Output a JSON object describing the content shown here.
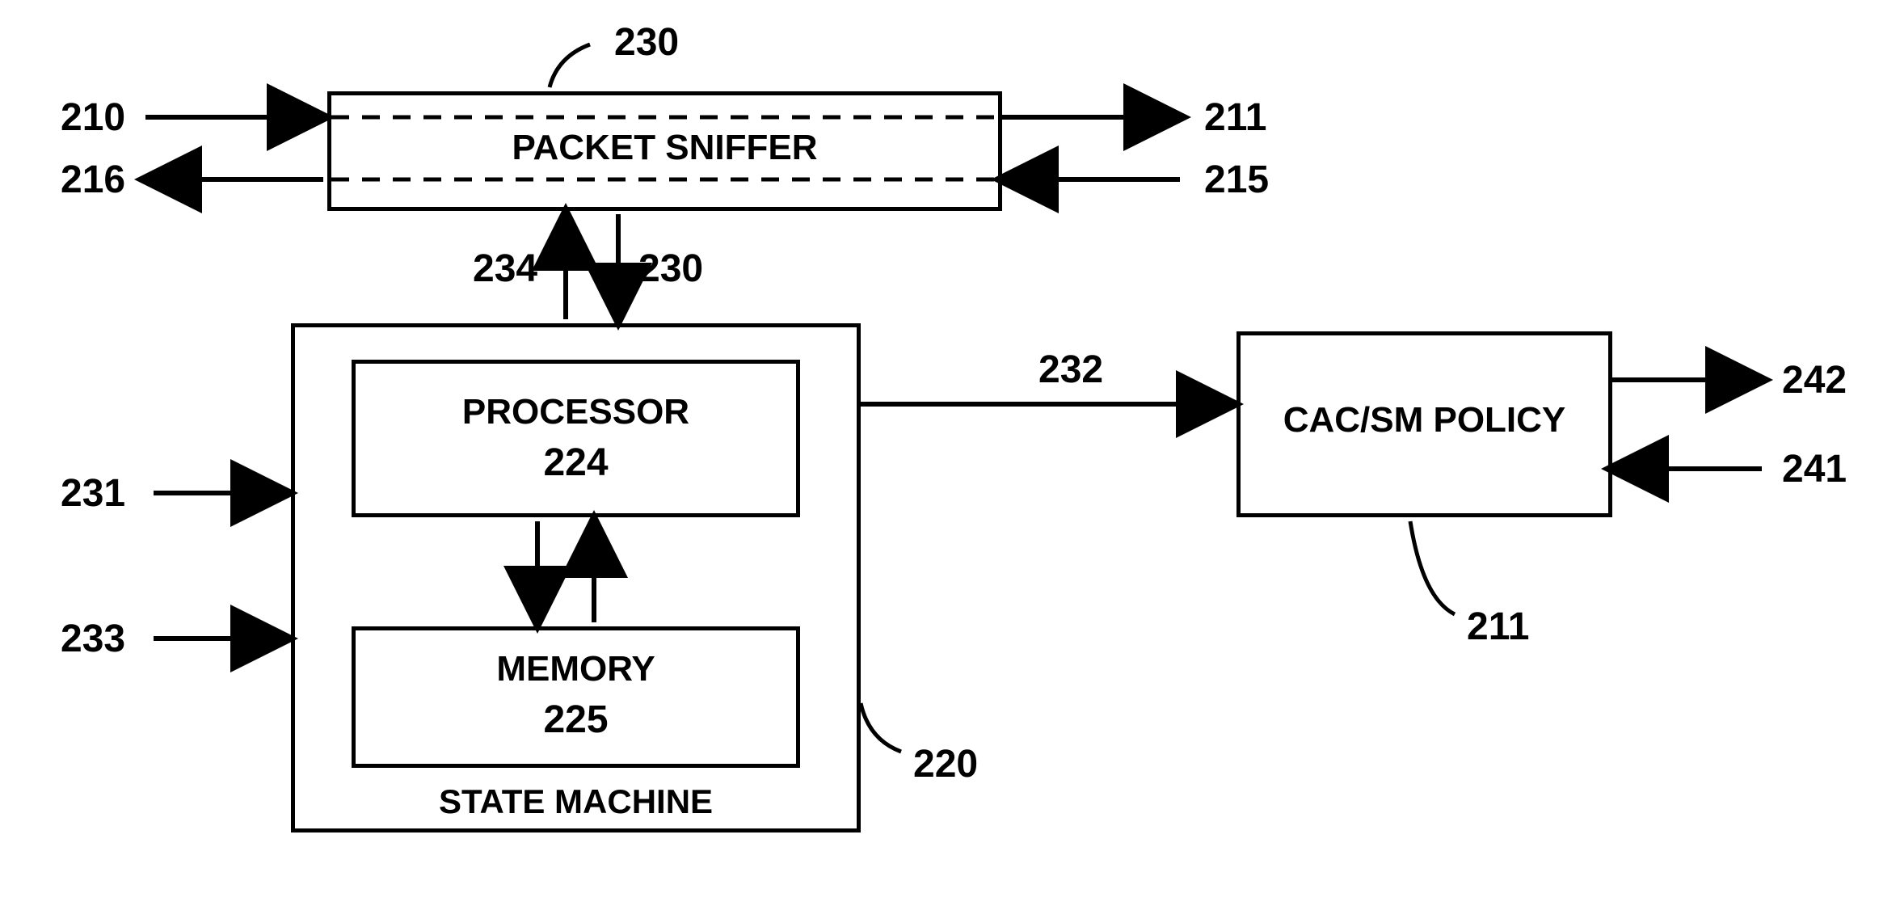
{
  "labels": {
    "l210": "210",
    "l211a": "211",
    "l216": "216",
    "l215": "215",
    "l230top": "230",
    "l234": "234",
    "l230mid": "230",
    "l231": "231",
    "l233": "233",
    "l220": "220",
    "l232": "232",
    "l211b": "211",
    "l241": "241",
    "l242": "242"
  },
  "boxes": {
    "packet_sniffer": "PACKET SNIFFER",
    "state_machine": "STATE MACHINE",
    "processor": "PROCESSOR",
    "processor_num": "224",
    "memory": "MEMORY",
    "memory_num": "225",
    "cac": "CAC/SM POLICY"
  }
}
